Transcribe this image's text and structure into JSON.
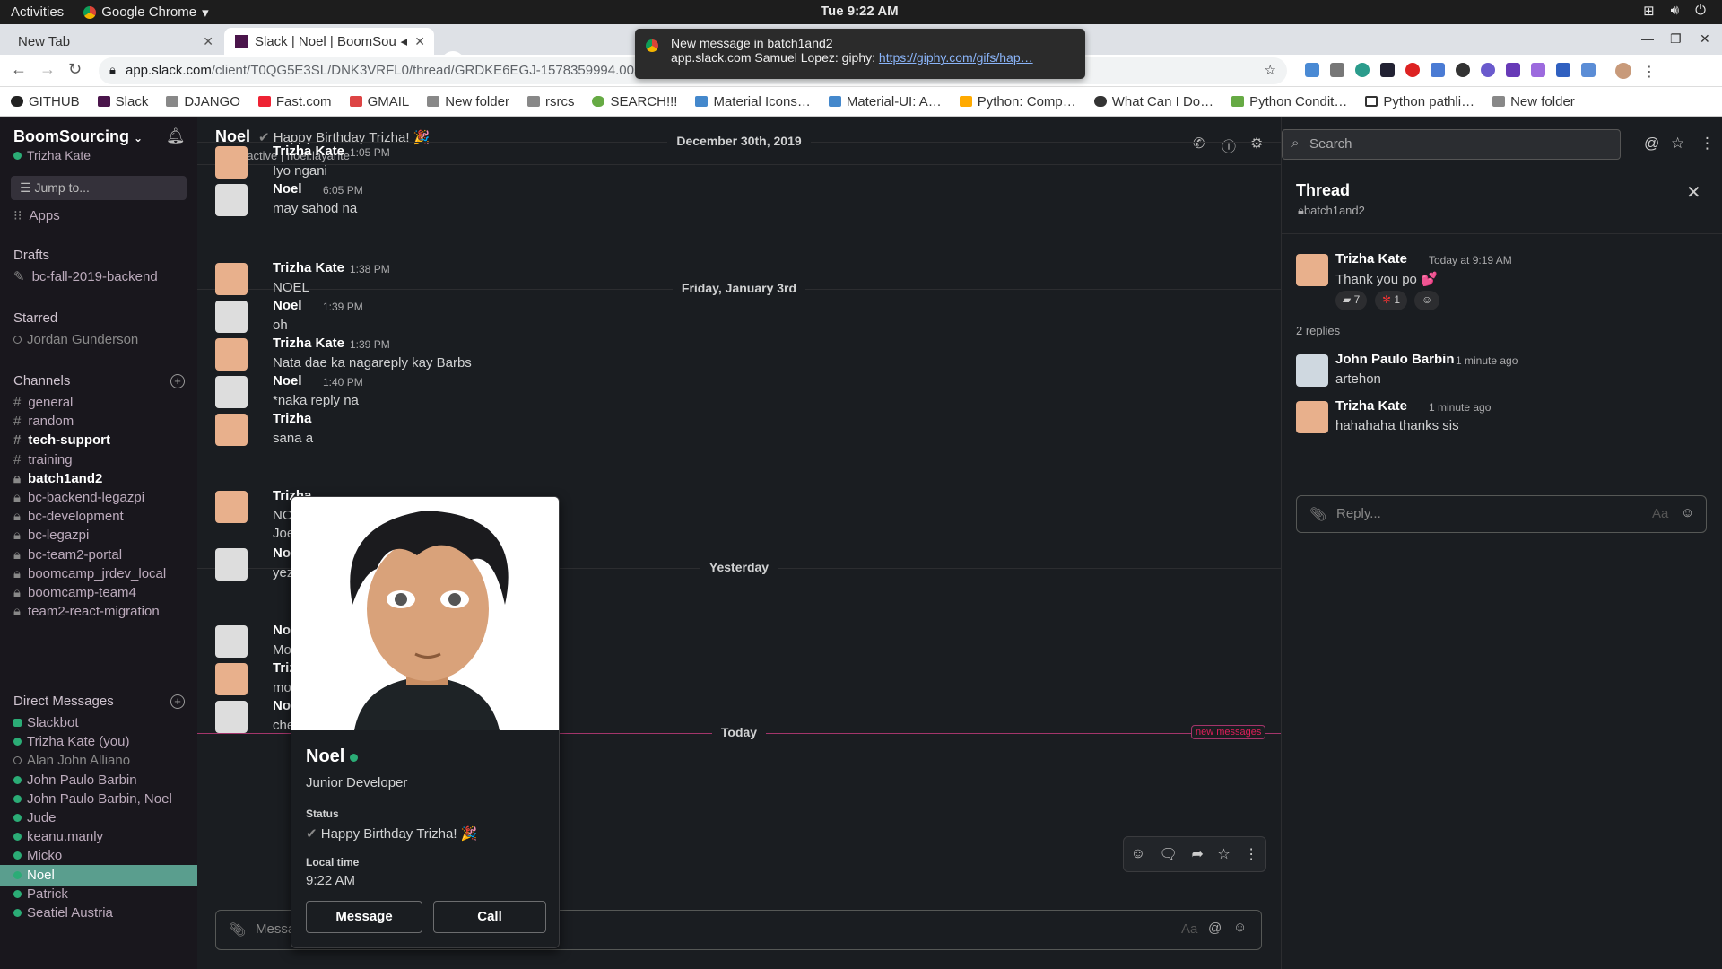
{
  "os": {
    "activities": "Activities",
    "app": "Google Chrome",
    "clock": "Tue  9:22 AM"
  },
  "tabs": [
    {
      "label": "New Tab"
    },
    {
      "label": "Slack | Noel | BoomSou"
    }
  ],
  "address": {
    "host": "app.slack.com",
    "path": "/client/T0QG5E3SL/DNK3VRFL0/thread/GRDKE6EGJ-1578359994.005900"
  },
  "bookmarks": [
    "GITHUB",
    "Slack",
    "DJANGO",
    "Fast.com",
    "GMAIL",
    "New folder",
    "rsrcs",
    "SEARCH!!!",
    "Material Icons…",
    "Material-UI: A…",
    "Python: Comp…",
    "What Can I Do…",
    "Python Condit…",
    "Python pathli…",
    "New folder"
  ],
  "notification": {
    "title": "New message in batch1and2",
    "body": "app.slack.com  Samuel Lopez: giphy: ",
    "link": "https://giphy.com/gifs/hap…"
  },
  "workspace": {
    "name": "BoomSourcing",
    "user": "Trizha Kate",
    "jump": "Jump to...",
    "apps": "Apps"
  },
  "sidebar": {
    "drafts_head": "Drafts",
    "drafts": [
      "bc-fall-2019-backend"
    ],
    "starred_head": "Starred",
    "starred": [
      "Jordan Gunderson"
    ],
    "channels_head": "Channels",
    "channels": [
      {
        "label": "general",
        "bold": false,
        "private": false
      },
      {
        "label": "random",
        "bold": false,
        "private": false
      },
      {
        "label": "tech-support",
        "bold": true,
        "private": false
      },
      {
        "label": "training",
        "bold": false,
        "private": false
      },
      {
        "label": "batch1and2",
        "bold": true,
        "private": true
      },
      {
        "label": "bc-backend-legazpi",
        "bold": false,
        "private": true
      },
      {
        "label": "bc-development",
        "bold": false,
        "private": true
      },
      {
        "label": "bc-legazpi",
        "bold": false,
        "private": true
      },
      {
        "label": "bc-team2-portal",
        "bold": false,
        "private": true
      },
      {
        "label": "boomcamp_jrdev_local",
        "bold": false,
        "private": true
      },
      {
        "label": "boomcamp-team4",
        "bold": false,
        "private": true
      },
      {
        "label": "team2-react-migration",
        "bold": false,
        "private": true
      }
    ],
    "dm_head": "Direct Messages",
    "dms": [
      "Slackbot",
      "Trizha Kate  (you)",
      "Alan John Alliano",
      "John Paulo Barbin",
      "John Paulo Barbin, Noel",
      "Jude",
      "keanu.manly",
      "Micko",
      "Noel",
      "Patrick",
      "Seatiel Austria"
    ]
  },
  "channel": {
    "name": "Noel",
    "status": "Happy Birthday Trizha! 🎉",
    "presence": "active",
    "handle": "noel.layante"
  },
  "dates": {
    "d1": "December 30th, 2019",
    "d2": "Friday, January 3rd",
    "d3": "Yesterday",
    "d4": "Today",
    "new": "new messages"
  },
  "messages": [
    {
      "author": "Trizha Kate",
      "time": "1:05 PM",
      "text": "Iyo ngani"
    },
    {
      "author": "Noel",
      "time": "6:05 PM",
      "text": "may sahod na"
    },
    {
      "author": "Trizha Kate",
      "time": "1:38 PM",
      "text": "NOEL"
    },
    {
      "author": "Noel",
      "time": "1:39 PM",
      "text": "oh"
    },
    {
      "author": "Trizha Kate",
      "time": "1:39 PM",
      "text": "Nata dae ka nagareply kay Barbs"
    },
    {
      "author": "Noel",
      "time": "1:40 PM",
      "text": "*naka reply na"
    },
    {
      "author": "Trizha",
      "time": "",
      "text": "sana a"
    },
    {
      "author": "Trizha",
      "time": "",
      "text": "NOel"
    },
    {
      "author": "",
      "time": "",
      "text": "Joey"
    },
    {
      "author": "Noel",
      "time": "",
      "text": "yez po"
    },
    {
      "author": "Noel",
      "time": "",
      "text": "Morni"
    },
    {
      "author": "Trizha",
      "time": "",
      "text": "mornin"
    },
    {
      "author": "Noel",
      "time": "",
      "text": "check"
    }
  ],
  "composer": {
    "placeholder": "Messa",
    "aa": "Aa"
  },
  "profile": {
    "name": "Noel",
    "title": "Junior Developer",
    "status_label": "Status",
    "status": "Happy Birthday Trizha! 🎉",
    "time_label": "Local time",
    "time": "9:22 AM",
    "message_btn": "Message",
    "call_btn": "Call"
  },
  "search": {
    "placeholder": "Search"
  },
  "thread": {
    "title": "Thread",
    "channel": "batch1and2",
    "parent": {
      "author": "Trizha Kate",
      "time": "Today at 9:19 AM",
      "text": "Thank you po 💕"
    },
    "reactions": [
      {
        "count": "7"
      },
      {
        "count": "1"
      }
    ],
    "replies_label": "2 replies",
    "replies": [
      {
        "author": "John Paulo Barbin",
        "time": "1 minute ago",
        "text": "artehon"
      },
      {
        "author": "Trizha Kate",
        "time": "1 minute ago",
        "text": "hahahaha thanks sis"
      }
    ],
    "reply_placeholder": "Reply...",
    "aa": "Aa"
  }
}
